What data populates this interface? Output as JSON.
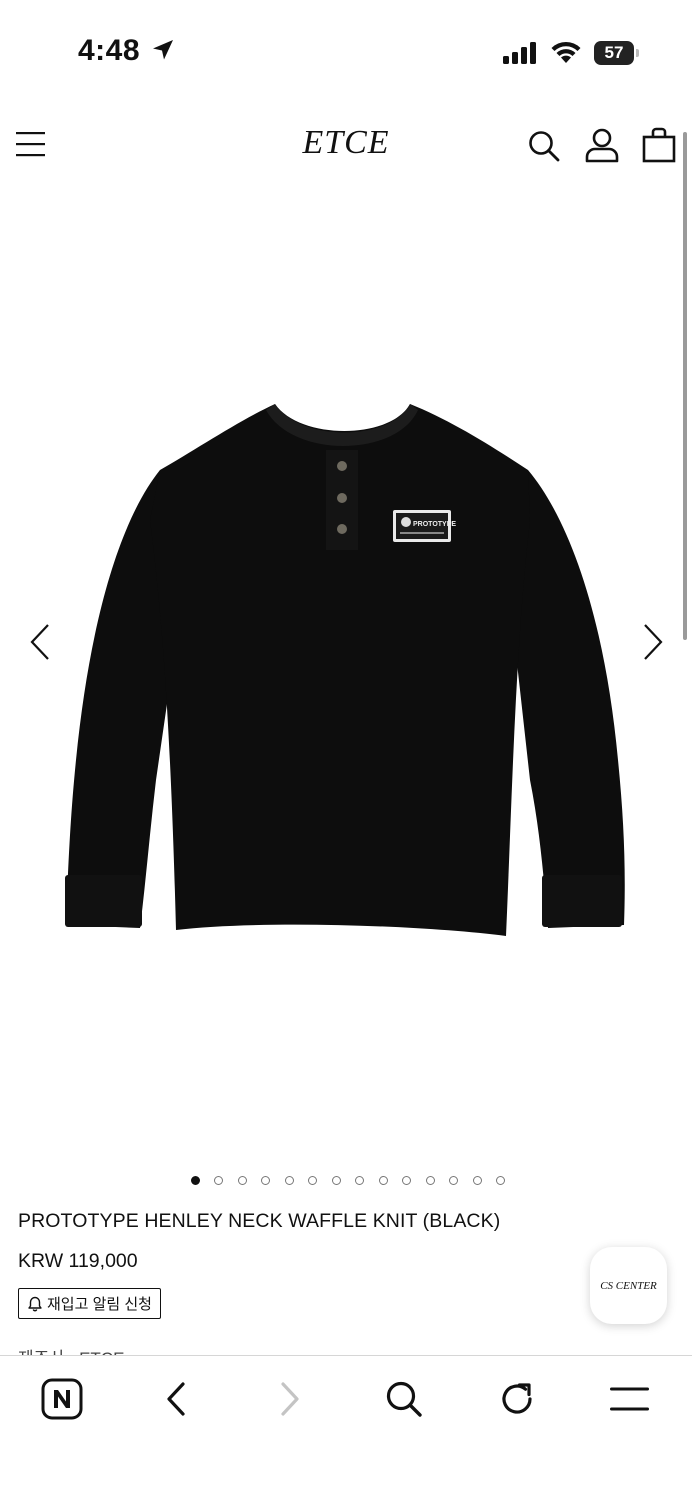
{
  "status_bar": {
    "time": "4:48",
    "battery": "57"
  },
  "header": {
    "logo": "ETCE"
  },
  "carousel": {
    "total_images": 14,
    "active_index": 0
  },
  "product": {
    "name": "PROTOTYPE HENLEY NECK WAFFLE KNIT (BLACK)",
    "price": "KRW 119,000",
    "restock_label": "재입고 알림 신청",
    "maker_line": "제조사 : ETCE",
    "patch_text": "PROTOTYPE"
  },
  "cs_center": {
    "label": "CS CENTER"
  },
  "colors": {
    "text": "#111111",
    "shirt": "#0d0d0d",
    "disabled": "#c4c4c4"
  },
  "icons": {
    "menu": "hamburger-icon",
    "search": "search-icon",
    "account": "user-icon",
    "bag": "shopping-bag-icon",
    "bell": "bell-icon",
    "browser_home": "naver-n-icon",
    "back": "chevron-left-icon",
    "forward": "chevron-right-icon",
    "reload": "reload-icon",
    "browser_menu": "hamburger-icon"
  }
}
